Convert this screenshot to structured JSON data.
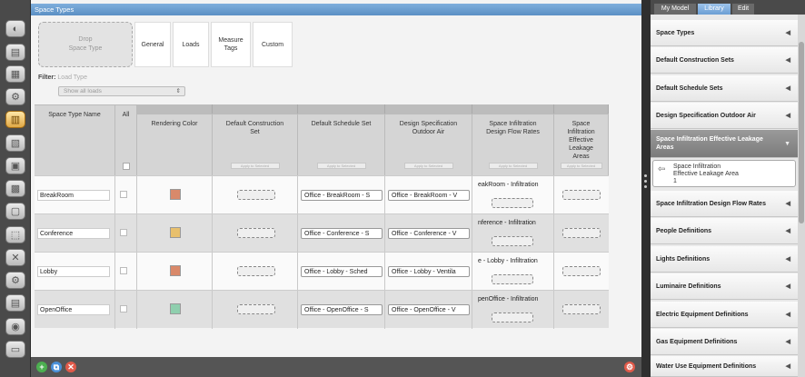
{
  "main": {
    "title": "Space Types",
    "drop_zone": "Drop\nSpace Type",
    "drop_line1": "Drop",
    "drop_line2": "Space Type",
    "tabs": [
      {
        "label": "General"
      },
      {
        "label": "Loads"
      },
      {
        "label_l1": "Measure",
        "label_l2": "Tags"
      },
      {
        "label": "Custom"
      }
    ],
    "filter": {
      "label": "Filter:",
      "placeholder": "Load Type",
      "selected": "Show all loads"
    }
  },
  "grid": {
    "headers": {
      "name": "Space Type Name",
      "all": "All",
      "color": "Rendering Color",
      "construction_l1": "Default Construction",
      "construction_l2": "Set",
      "schedule": "Default Schedule Set",
      "dsoa_l1": "Design Specification",
      "dsoa_l2": "Outdoor Air",
      "sidfr_l1": "Space Infiltration",
      "sidfr_l2": "Design Flow Rates",
      "siela_l1": "Space Infiltration",
      "siela_l2": "Effective Leakage",
      "siela_l3": "Areas",
      "apply_label": "Apply to Selected"
    },
    "rows": [
      {
        "name": "BreakRoom",
        "color": "#d9896a",
        "schedule": "Office - BreakRoom - S",
        "dsoa": "Office - BreakRoom - V",
        "infiltration": "eakRoom - Infiltration"
      },
      {
        "name": "Conference",
        "color": "#e8c06d",
        "schedule": "Office - Conference - S",
        "dsoa": "Office - Conference - V",
        "infiltration": "nference - Infiltration"
      },
      {
        "name": "Lobby",
        "color": "#d9896a",
        "schedule": "Office - Lobby - Sched",
        "dsoa": "Office - Lobby - Ventila",
        "infiltration": "e - Lobby - Infiltration"
      },
      {
        "name": "OpenOffice",
        "color": "#8fcfae",
        "schedule": "Office - OpenOffice - S",
        "dsoa": "Office - OpenOffice - V",
        "infiltration": "penOffice - Infiltration"
      }
    ]
  },
  "right_panel": {
    "tabs": [
      "My Model",
      "Library",
      "Edit"
    ],
    "items": [
      "Space Types",
      "Default Construction Sets",
      "Default Schedule Sets",
      "Design Specification Outdoor Air",
      "Space Infiltration Effective Leakage Areas",
      "Space Infiltration Design Flow Rates",
      "People Definitions",
      "Lights Definitions",
      "Luminaire Definitions",
      "Electric Equipment Definitions",
      "Gas Equipment Definitions",
      "Water Use Equipment Definitions"
    ],
    "open_item_l1": "Space Infiltration Effective Leakage",
    "open_item_l2": "Areas",
    "sub_item": {
      "line1": "Space Infiltration",
      "line2": "Effective Leakage Area",
      "line3": "1"
    }
  },
  "colors": {
    "accent": "#6c9ed4",
    "active_icon": "#e0a846"
  }
}
